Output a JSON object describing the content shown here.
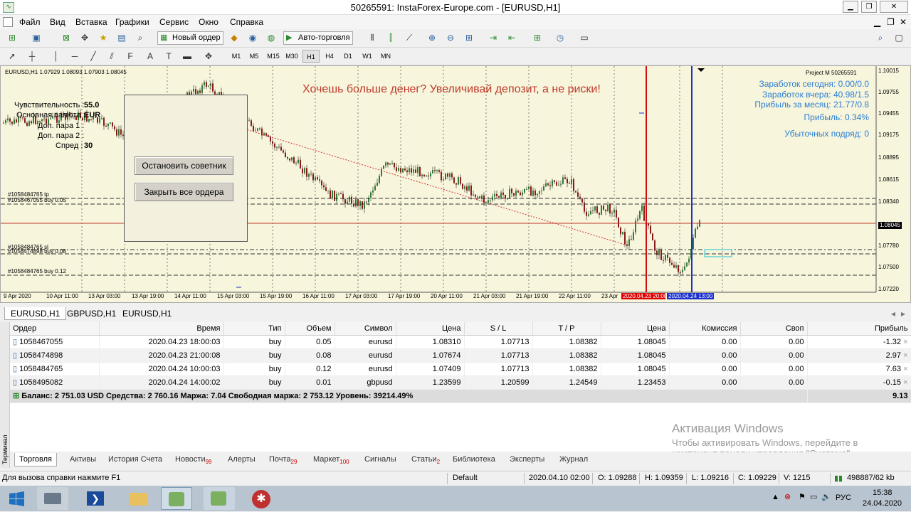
{
  "window": {
    "title": "50265591: InstaForex-Europe.com - [EURUSD,H1]"
  },
  "menu": [
    "Файл",
    "Вид",
    "Вставка",
    "Графики",
    "Сервис",
    "Окно",
    "Справка"
  ],
  "toolbar": {
    "new_order": "Новый ордер",
    "auto_trading": "Авто-торговля"
  },
  "timeframes": [
    "M1",
    "M5",
    "M15",
    "M30",
    "H1",
    "H4",
    "D1",
    "W1",
    "MN"
  ],
  "chart": {
    "header": "EURUSD,H1  1.07929 1.08093 1.07903 1.08045",
    "banner": "Хочешь больше денег? Увеличивай депозит, а не риски!",
    "project_label": "Project M   50265591",
    "stats": [
      "Заработок сегодня: 0.00/0.0",
      "Заработок вчера: 40.98/1.5",
      "Прибыль за месяц: 21.77/0.8",
      "Прибыль: 0.34%",
      "Убыточных подряд: 0"
    ],
    "settings": {
      "sensitivity_label": "Чувствительность :",
      "sensitivity_value": "55.0",
      "base_label": "Основная валюта :",
      "base_value": "EUR",
      "pair1_label": "Доп. пара 1 :",
      "pair2_label": "Доп. пара 2 :",
      "spread_label": "Спред :",
      "spread_value": "30"
    },
    "buttons": {
      "stop": "Остановить советник",
      "close_all": "Закрыть все ордера"
    },
    "order_lines": [
      "#1058484765 tp",
      "#1058467055 buy 0.05",
      "#1058484765 sl",
      "#1058474898 buy 0.08",
      "#1058484765 buy 0.12"
    ],
    "price_labels": [
      "1.10015",
      "1.09755",
      "1.09455",
      "1.09175",
      "1.08895",
      "1.08615",
      "1.08340",
      "1.08045",
      "1.07780",
      "1.07500",
      "1.07220"
    ],
    "current_price": "1.08045",
    "time_labels": [
      "9 Apr 2020",
      "10 Apr 11:00",
      "13 Apr 03:00",
      "13 Apr 19:00",
      "14 Apr 11:00",
      "15 Apr 03:00",
      "15 Apr 19:00",
      "16 Apr 11:00",
      "17 Apr 03:00",
      "17 Apr 19:00",
      "20 Apr 11:00",
      "21 Apr 03:00",
      "21 Apr 19:00",
      "22 Apr 11:00",
      "23 Apr"
    ],
    "vline_labels": [
      "2020.04.23 20:00",
      "2020.04.24 13:00"
    ]
  },
  "chart_tabs": [
    "EURUSD,H1",
    "GBPUSD,H1",
    "EURUSD,H1"
  ],
  "orders": {
    "columns": [
      "Ордер",
      "Время",
      "Тип",
      "Объем",
      "Символ",
      "Цена",
      "S / L",
      "T / P",
      "Цена",
      "Комиссия",
      "Своп",
      "Прибыль"
    ],
    "rows": [
      [
        "1058467055",
        "2020.04.23 18:00:03",
        "buy",
        "0.05",
        "eurusd",
        "1.08310",
        "1.07713",
        "1.08382",
        "1.08045",
        "0.00",
        "0.00",
        "-1.32"
      ],
      [
        "1058474898",
        "2020.04.23 21:00:08",
        "buy",
        "0.08",
        "eurusd",
        "1.07674",
        "1.07713",
        "1.08382",
        "1.08045",
        "0.00",
        "0.00",
        "2.97"
      ],
      [
        "1058484765",
        "2020.04.24 10:00:03",
        "buy",
        "0.12",
        "eurusd",
        "1.07409",
        "1.07713",
        "1.08382",
        "1.08045",
        "0.00",
        "0.00",
        "7.63"
      ],
      [
        "1058495082",
        "2020.04.24 14:00:02",
        "buy",
        "0.01",
        "gbpusd",
        "1.23599",
        "1.20599",
        "1.24549",
        "1.23453",
        "0.00",
        "0.00",
        "-0.15"
      ]
    ],
    "balance": "Баланс: 2 751.03 USD  Средства: 2 760.16  Маржа: 7.04  Свободная маржа: 2 753.12  Уровень: 39214.49%",
    "total_profit": "9.13"
  },
  "terminal_label": "Терминал",
  "bottom_tabs": [
    {
      "label": "Торговля",
      "badge": ""
    },
    {
      "label": "Активы",
      "badge": ""
    },
    {
      "label": "История Счета",
      "badge": ""
    },
    {
      "label": "Новости",
      "badge": "99"
    },
    {
      "label": "Алерты",
      "badge": ""
    },
    {
      "label": "Почта",
      "badge": "29"
    },
    {
      "label": "Маркет",
      "badge": "100"
    },
    {
      "label": "Сигналы",
      "badge": ""
    },
    {
      "label": "Статьи",
      "badge": "2"
    },
    {
      "label": "Библиотека",
      "badge": ""
    },
    {
      "label": "Эксперты",
      "badge": ""
    },
    {
      "label": "Журнал",
      "badge": ""
    }
  ],
  "status": {
    "help": "Для вызова справки нажмите F1",
    "profile": "Default",
    "time": "2020.04.10 02:00",
    "open": "O: 1.09288",
    "high": "H: 1.09359",
    "low": "L: 1.09216",
    "close": "C: 1.09229",
    "volume": "V: 1215",
    "traffic": "498887/62 kb"
  },
  "watermark": {
    "title": "Активация Windows",
    "line1": "Чтобы активировать Windows, перейдите в",
    "line2": "компонент панели управления \"Система\"."
  },
  "taskbar": {
    "lang": "РУС",
    "clock_time": "15:38",
    "clock_date": "24.04.2020"
  },
  "colors": {
    "chart_bg": "#f7f5dc",
    "candle_up": "#2e7d32",
    "candle_down": "#8b1a1a",
    "stats_blue": "#2a7fd4",
    "banner_red": "#c0392b"
  }
}
